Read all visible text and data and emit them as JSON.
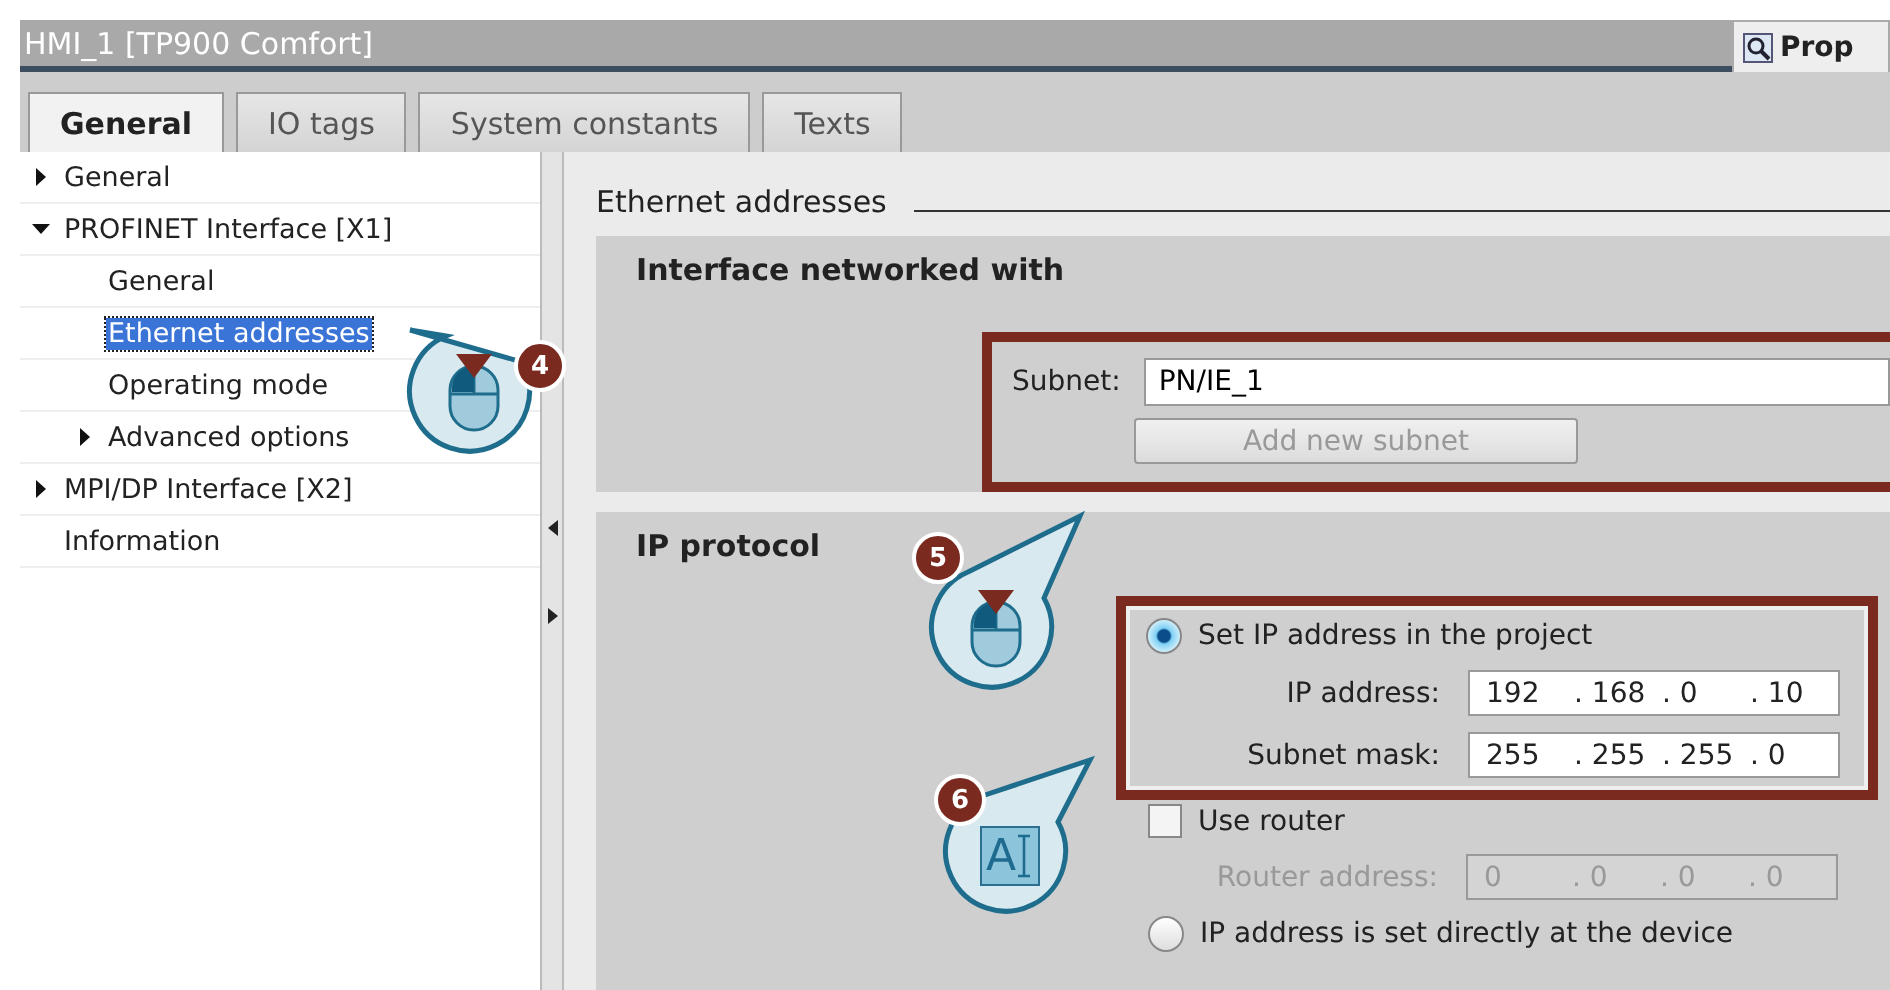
{
  "window": {
    "title": "HMI_1 [TP900 Comfort]",
    "side_tab": "Prop"
  },
  "tabs": [
    {
      "label": "General",
      "selected": true
    },
    {
      "label": "IO tags",
      "selected": false
    },
    {
      "label": "System constants",
      "selected": false
    },
    {
      "label": "Texts",
      "selected": false
    }
  ],
  "tree": [
    {
      "label": "General",
      "expanded": false,
      "selected": false
    },
    {
      "label": "PROFINET Interface [X1]",
      "expanded": true,
      "selected": false,
      "children": [
        {
          "label": "General",
          "selected": false
        },
        {
          "label": "Ethernet addresses",
          "selected": true
        },
        {
          "label": "Operating mode",
          "selected": false
        },
        {
          "label": "Advanced options",
          "expanded": false,
          "selected": false
        }
      ]
    },
    {
      "label": "MPI/DP Interface [X2]",
      "expanded": false,
      "selected": false
    },
    {
      "label": "Information",
      "selected": false
    }
  ],
  "page_title": "Ethernet addresses",
  "interface_section": {
    "title": "Interface networked with",
    "subnet_label": "Subnet:",
    "subnet_value": "PN/IE_1",
    "add_button": {
      "label": "Add new subnet",
      "disabled": true
    }
  },
  "ip_section": {
    "title": "IP protocol",
    "set_in_project": {
      "label": "Set IP address in the project",
      "selected": true
    },
    "ip_address": {
      "label": "IP address:",
      "octets": [
        "192",
        "168",
        "0",
        "10"
      ],
      "separator": ".",
      "disabled": false
    },
    "subnet_mask": {
      "label": "Subnet mask:",
      "octets": [
        "255",
        "255",
        "255",
        "0"
      ],
      "separator": ".",
      "disabled": false
    },
    "use_router": {
      "label": "Use router",
      "checked": false
    },
    "router_address": {
      "label": "Router address:",
      "octets": [
        "0",
        "0",
        "0",
        "0"
      ],
      "separator": ".",
      "disabled": true
    },
    "set_at_device": {
      "label": "IP address is set directly at the device",
      "selected": false
    }
  },
  "callouts": [
    {
      "number": "4",
      "kind": "mouse"
    },
    {
      "number": "5",
      "kind": "mouse"
    },
    {
      "number": "6",
      "kind": "text",
      "glyph": "A"
    }
  ]
}
